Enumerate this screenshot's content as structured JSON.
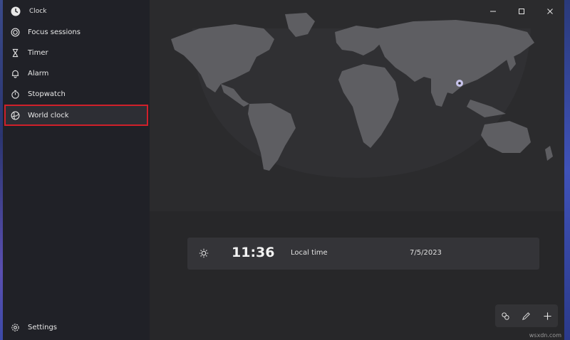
{
  "app": {
    "title": "Clock"
  },
  "sidebar": {
    "items": [
      {
        "label": "Focus sessions",
        "icon": "focus-icon"
      },
      {
        "label": "Timer",
        "icon": "hourglass-icon"
      },
      {
        "label": "Alarm",
        "icon": "bell-icon"
      },
      {
        "label": "Stopwatch",
        "icon": "stopwatch-icon"
      },
      {
        "label": "World clock",
        "icon": "globe-icon",
        "selected": true
      }
    ],
    "settings_label": "Settings"
  },
  "world_clock": {
    "time": "11:36",
    "label": "Local time",
    "date": "7/5/2023"
  },
  "watermark": "wsxdn.com",
  "colors": {
    "highlight_outline": "#d0202a",
    "land": "#5e5e62",
    "sidebar_bg": "#202127",
    "card_bg": "#343438"
  }
}
